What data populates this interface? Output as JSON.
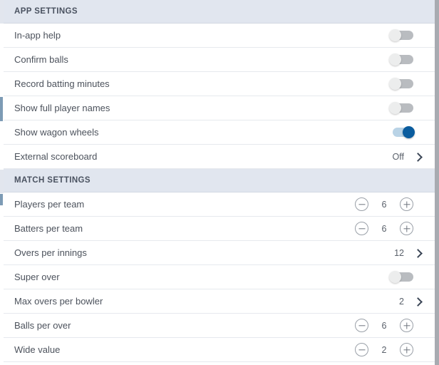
{
  "scrollbar": {
    "present": true,
    "color": "#a8abb1"
  },
  "colors": {
    "section_header_bg": "#e1e6ef",
    "section_header_text": "#4a5260",
    "row_bg": "#ffffff",
    "row_text": "#4c525c",
    "divider": "#e6e9ee",
    "toggle_on": "#0a5c9e",
    "toggle_on_track": "#b9d3e6",
    "toggle_off_track": "#b9bcc0",
    "toggle_off_knob": "#eceded",
    "stepper_border": "#9aa0a8",
    "chevron": "#3b4656"
  },
  "sections": [
    {
      "title": "APP SETTINGS",
      "name": "app-settings",
      "rows": [
        {
          "label": "In-app help",
          "name": "in-app-help",
          "control": "toggle",
          "state": "off"
        },
        {
          "label": "Confirm balls",
          "name": "confirm-balls",
          "control": "toggle",
          "state": "off"
        },
        {
          "label": "Record batting minutes",
          "name": "record-batting-minutes",
          "control": "toggle",
          "state": "off"
        },
        {
          "label": "Show full player names",
          "name": "show-full-player-names",
          "control": "toggle",
          "state": "off"
        },
        {
          "label": "Show wagon wheels",
          "name": "show-wagon-wheels",
          "control": "toggle",
          "state": "on"
        },
        {
          "label": "External scoreboard",
          "name": "external-scoreboard",
          "control": "disclosure",
          "value": "Off"
        }
      ]
    },
    {
      "title": "MATCH SETTINGS",
      "name": "match-settings",
      "rows": [
        {
          "label": "Players per team",
          "name": "players-per-team",
          "control": "stepper",
          "value": "6"
        },
        {
          "label": "Batters per team",
          "name": "batters-per-team",
          "control": "stepper",
          "value": "6"
        },
        {
          "label": "Overs per innings",
          "name": "overs-per-innings",
          "control": "disclosure",
          "value": "12"
        },
        {
          "label": "Super over",
          "name": "super-over",
          "control": "toggle",
          "state": "off"
        },
        {
          "label": "Max overs per bowler",
          "name": "max-overs-per-bowler",
          "control": "disclosure",
          "value": "2"
        },
        {
          "label": "Balls per over",
          "name": "balls-per-over",
          "control": "stepper",
          "value": "6"
        },
        {
          "label": "Wide value",
          "name": "wide-value",
          "control": "stepper",
          "value": "2"
        }
      ]
    }
  ],
  "icons": {
    "chevron": "chevron-right-icon",
    "minus": "minus-circle-icon",
    "plus": "plus-circle-icon"
  }
}
